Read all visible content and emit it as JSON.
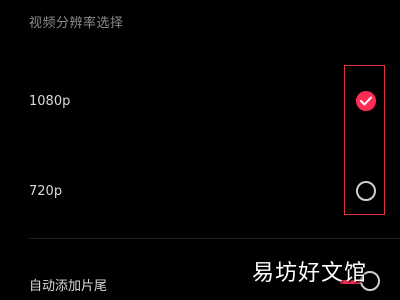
{
  "section_title": "视频分辨率选择",
  "options": [
    {
      "label": "1080p",
      "selected": true
    },
    {
      "label": "720p",
      "selected": false
    }
  ],
  "auto_ending": {
    "label": "自动添加片尾",
    "enabled": true
  },
  "watermark": "易坊好文馆",
  "colors": {
    "accent": "#ff2d55",
    "highlight_border": "#e0303a",
    "background": "#000000"
  },
  "icons": {
    "selected": "check-circle-icon",
    "unselected": "radio-circle-icon"
  }
}
